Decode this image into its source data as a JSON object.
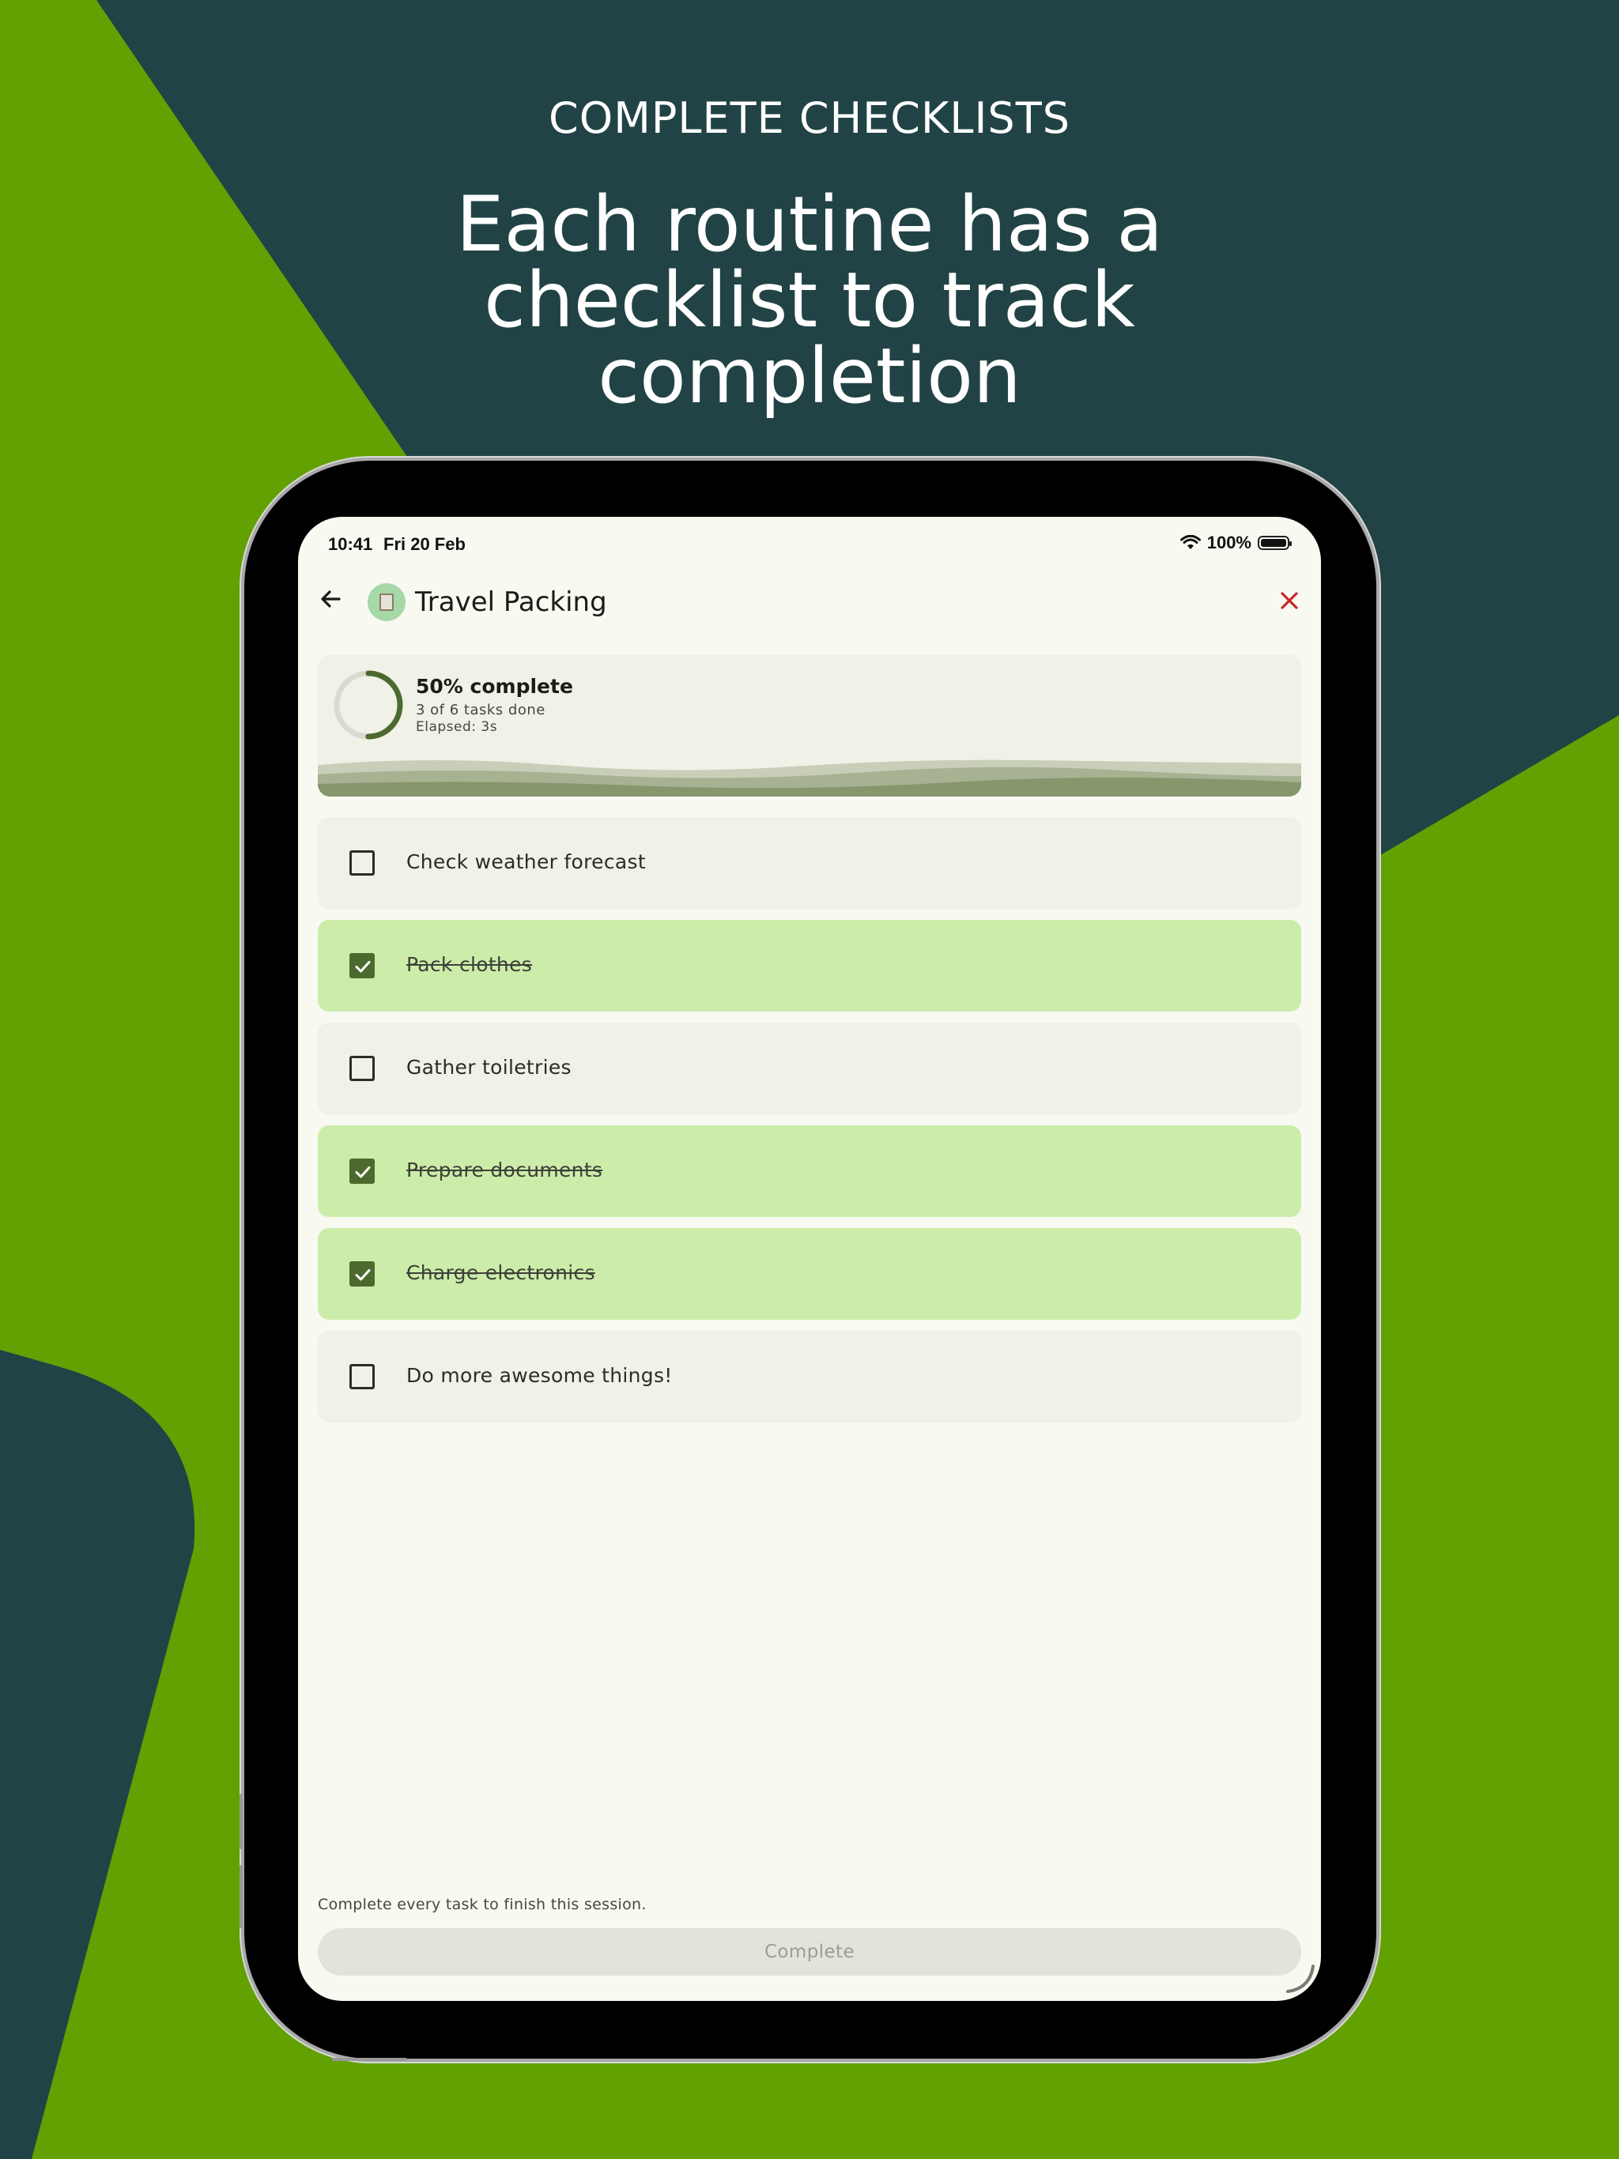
{
  "marketing": {
    "kicker": "COMPLETE CHECKLISTS",
    "headline": "Each routine has a checklist to track completion"
  },
  "status_bar": {
    "time": "10:41",
    "date": "Fri 20 Feb",
    "battery": "100%"
  },
  "app_bar": {
    "title": "Travel Packing",
    "back_icon": "arrow-left-icon",
    "close_icon": "close-icon",
    "routine_icon": "clipboard-icon"
  },
  "progress": {
    "title": "50% complete",
    "subtitle": "3 of 6 tasks done",
    "elapsed": "Elapsed: 3s",
    "fraction": 0.5
  },
  "tasks": [
    {
      "label": "Check weather forecast",
      "checked": false
    },
    {
      "label": "Pack clothes",
      "checked": true
    },
    {
      "label": "Gather toiletries",
      "checked": false
    },
    {
      "label": "Prepare documents",
      "checked": true
    },
    {
      "label": "Charge electronics",
      "checked": true
    },
    {
      "label": "Do more awesome things!",
      "checked": false
    }
  ],
  "footer": {
    "note": "Complete every task to finish this session.",
    "complete_label": "Complete"
  },
  "colors": {
    "background_green": "#62a102",
    "background_dark": "#214345",
    "done_row": "#ccedaa",
    "accent": "#4c6a2e",
    "close_red": "#c62828"
  }
}
